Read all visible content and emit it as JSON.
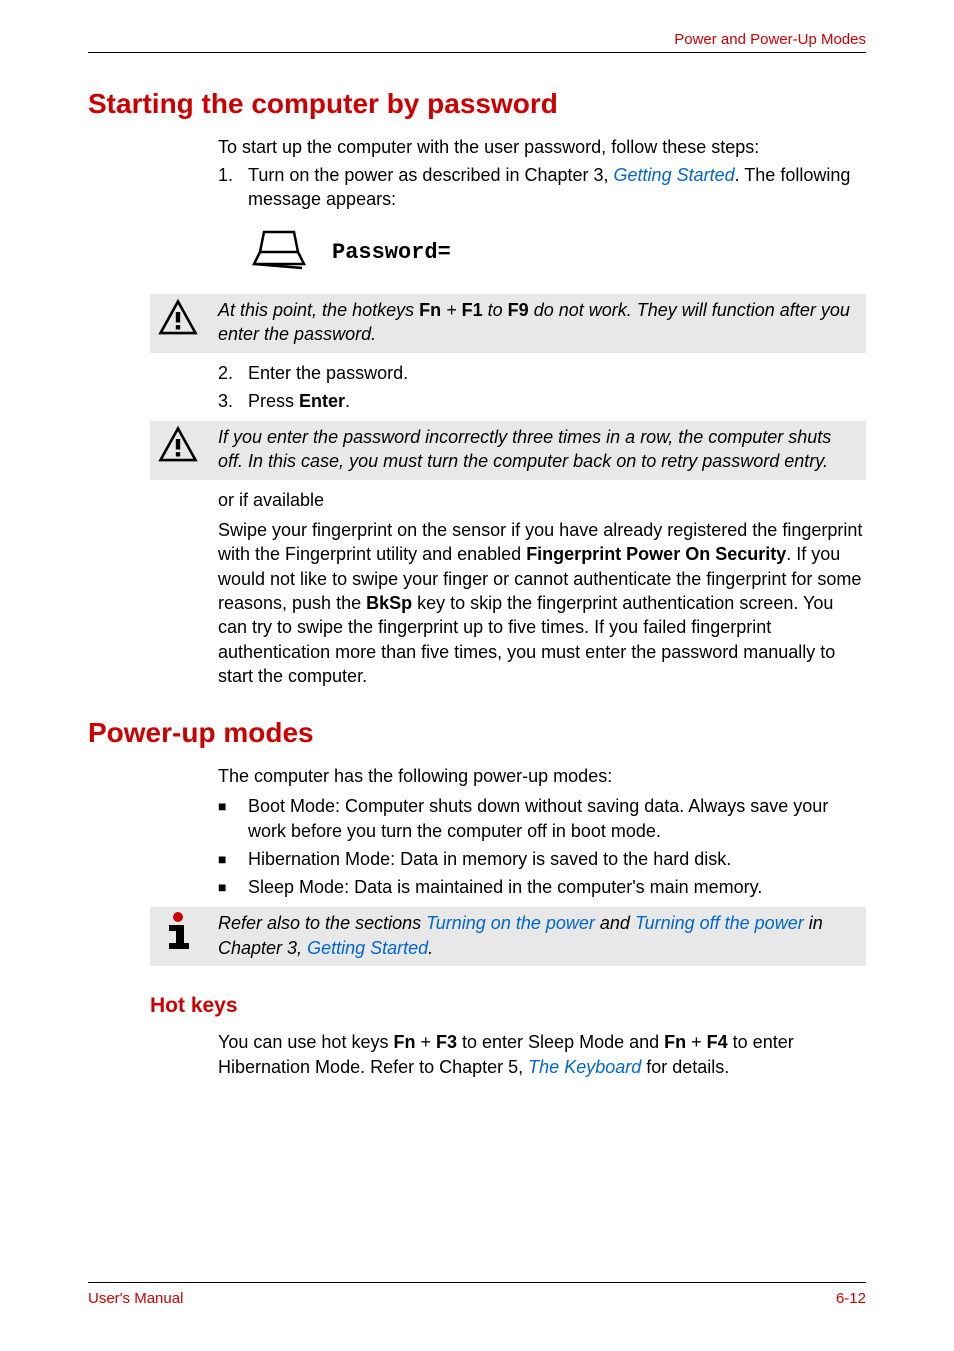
{
  "header": {
    "section": "Power and Power-Up Modes"
  },
  "section1": {
    "title": "Starting the computer by password",
    "intro": "To start up the computer with the user password, follow these steps:",
    "step1_num": "1.",
    "step1_a": "Turn on the power as described in Chapter 3, ",
    "step1_link": "Getting Started",
    "step1_b": ". The following message appears:",
    "prompt": "Password=",
    "callout1_a": "At this point, the hotkeys ",
    "callout1_fn": "Fn",
    "callout1_plus": " + ",
    "callout1_f1": "F1",
    "callout1_mid": " to ",
    "callout1_f9": "F9",
    "callout1_b": " do not work. They will function after you enter the password.",
    "step2_num": "2.",
    "step2": "Enter the password.",
    "step3_num": "3.",
    "step3_a": "Press ",
    "step3_b": "Enter",
    "step3_c": ".",
    "callout2": "If you enter the password incorrectly three times in a row, the computer shuts off. In this case, you must turn the computer back on to retry password entry.",
    "orif": "or if available",
    "fp_a": "Swipe your fingerprint on the sensor if you have already registered the fingerprint with the Fingerprint utility and enabled ",
    "fp_b": "Fingerprint Power On Security",
    "fp_c": ". If you would not like to swipe your finger or cannot authenticate the fingerprint for some reasons, push the ",
    "fp_d": "BkSp",
    "fp_e": " key to skip the fingerprint authentication screen. You can try to swipe the fingerprint up to five times. If you failed fingerprint authentication more than five times, you must enter the password manually to start the computer."
  },
  "section2": {
    "title": "Power-up modes",
    "intro": "The computer has the following power-up modes:",
    "bullet1": "Boot Mode: Computer shuts down without saving data. Always save your work before you turn the computer off in boot mode.",
    "bullet2": "Hibernation Mode: Data in memory is saved to the hard disk.",
    "bullet3": "Sleep Mode: Data is maintained in the computer's main memory.",
    "callout_a": "Refer also to the sections ",
    "callout_link1": "Turning on the power",
    "callout_mid": " and ",
    "callout_link2": "Turning off the power",
    "callout_b": " in Chapter 3, ",
    "callout_link3": "Getting Started",
    "callout_c": "."
  },
  "section3": {
    "title": "Hot keys",
    "body_a": "You can use hot keys ",
    "body_fn1": "Fn",
    "body_plus1": " + ",
    "body_f3": "F3",
    "body_mid1": " to enter Sleep Mode and ",
    "body_fn2": "Fn",
    "body_plus2": " + ",
    "body_f4": "F4",
    "body_mid2": " to enter Hibernation Mode. Refer to Chapter 5, ",
    "body_link": "The Keyboard",
    "body_end": " for details."
  },
  "footer": {
    "left": "User's Manual",
    "right": "6-12"
  }
}
